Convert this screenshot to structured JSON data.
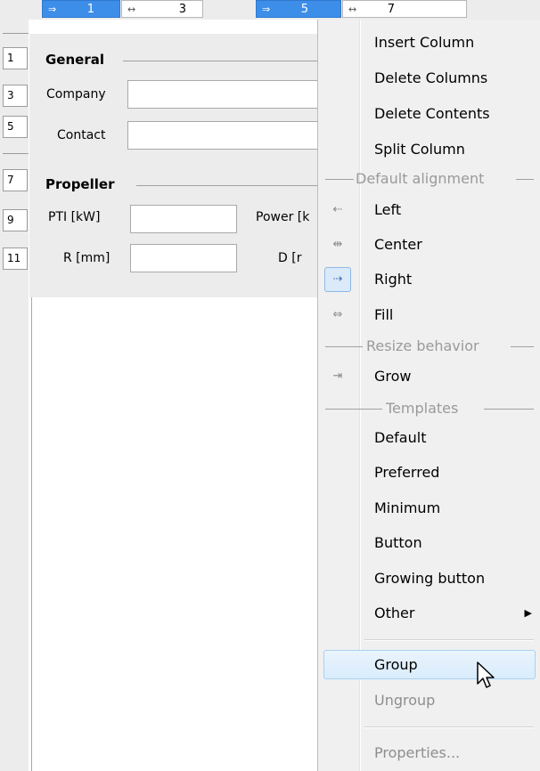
{
  "column_headers": [
    {
      "arrow": "⇒",
      "number": "1",
      "selected": true
    },
    {
      "arrow": "↔",
      "number": "3",
      "selected": false
    },
    {
      "arrow": "⇒",
      "number": "5",
      "selected": true
    },
    {
      "arrow": "↔",
      "number": "7",
      "selected": false
    }
  ],
  "row_headers": [
    "1",
    "3",
    "5",
    "7",
    "9",
    "11"
  ],
  "form": {
    "general_title": "General",
    "company_label": "Company",
    "contact_label": "Contact",
    "propeller_title": "Propeller",
    "pti_label": "PTI [kW]",
    "power_label": "Power [k",
    "r_label": "R [mm]",
    "d_label": "D [r"
  },
  "menu": {
    "insert_column": "Insert Column",
    "delete_columns": "Delete Columns",
    "delete_contents": "Delete Contents",
    "split_column": "Split Column",
    "default_alignment_header": "Default alignment",
    "left": "Left",
    "left_icon": "⇠",
    "center": "Center",
    "center_icon": "⇹",
    "right": "Right",
    "right_icon": "⇢",
    "fill": "Fill",
    "fill_icon": "⇔",
    "resize_behavior_header": "Resize behavior",
    "grow": "Grow",
    "grow_icon": "⇥",
    "templates_header": "Templates",
    "default": "Default",
    "preferred": "Preferred",
    "minimum": "Minimum",
    "button": "Button",
    "growing_button": "Growing button",
    "other": "Other",
    "group": "Group",
    "ungroup": "Ungroup",
    "properties": "Properties..."
  },
  "colors": {
    "selection_blue": "#3d8ee8",
    "menu_background": "#f0f0f0",
    "highlight_border": "#a8d1f3"
  }
}
